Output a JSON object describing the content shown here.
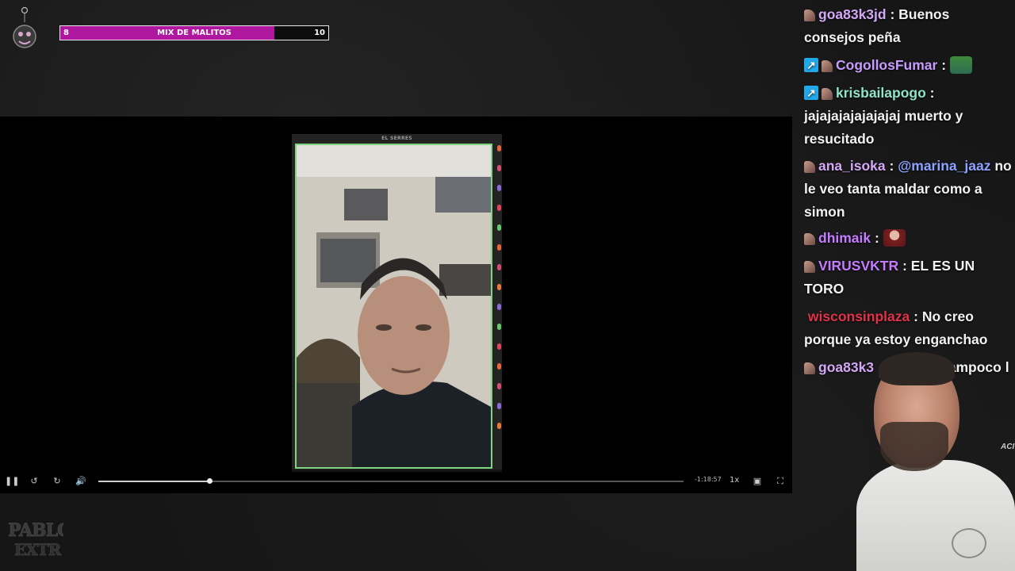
{
  "goal": {
    "current": "8",
    "title": "MIX DE MALITOS",
    "target": "10",
    "progress_fraction": 0.8,
    "fill_color": "#b0179f"
  },
  "player": {
    "overlay_label": "EL SERRES",
    "time_remaining": "-1:18:57",
    "speed": "1x",
    "progress_fraction": 0.19,
    "buffer_fraction": 0.165,
    "controls": [
      "pause-icon",
      "rewind-icon",
      "forward-icon",
      "volume-icon",
      "pip-icon",
      "fullscreen-icon"
    ]
  },
  "channel_logo_text": "PABLO\nEXTR",
  "chat": {
    "messages": [
      {
        "user": "goa83k3jd",
        "color": "#d3a8f5",
        "badges": [
          "hand"
        ],
        "text": "Buenos consejos peña",
        "mention": "",
        "emote": ""
      },
      {
        "user": "CogollosFumar",
        "color": "#c79cff",
        "badges": [
          "sub",
          "hand"
        ],
        "text": "",
        "mention": "",
        "emote": "frog-emote"
      },
      {
        "user": "krisbailapogo",
        "color": "#8fe3c7",
        "badges": [
          "sub",
          "hand"
        ],
        "text": "jajajajajajajajaj muerto y resucitado",
        "mention": "",
        "emote": ""
      },
      {
        "user": "ana_isoka",
        "color": "#d3a8f5",
        "badges": [
          "hand"
        ],
        "text": "no le veo tanta maldar como a simon",
        "mention": "@marina_jaaz",
        "emote": ""
      },
      {
        "user": "dhimaik",
        "color": "#c57cff",
        "badges": [
          "hand"
        ],
        "text": "",
        "mention": "",
        "emote": "person-emote"
      },
      {
        "user": "VIRUSVKTR",
        "color": "#c57cff",
        "badges": [
          "hand"
        ],
        "text": "EL ES UN TORO",
        "mention": "",
        "emote": ""
      },
      {
        "user": "wisconsinplaza",
        "color": "#e0334a",
        "badges": [],
        "text": "No creo porque ya estoy enganchao",
        "mention": "",
        "emote": ""
      },
      {
        "user": "goa83k3",
        "color": "#d3a8f5",
        "badges": [
          "hand"
        ],
        "text": "nkis tampoco l",
        "mention": "",
        "emote": ""
      }
    ]
  },
  "webcam": {
    "chair_text": "ACI"
  }
}
